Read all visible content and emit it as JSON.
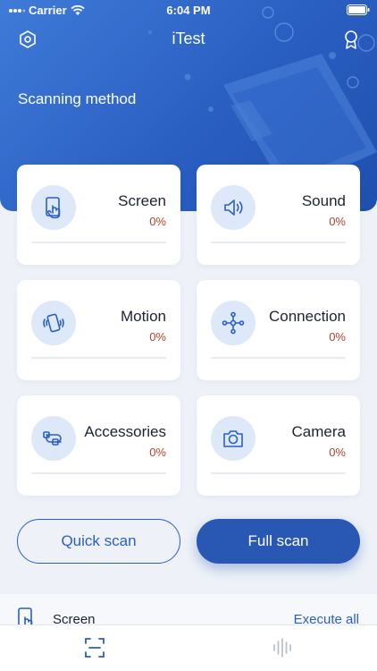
{
  "status_bar": {
    "carrier": "Carrier",
    "time": "6:04 PM"
  },
  "navbar": {
    "title": "iTest",
    "left_icon": "settings-hexagon-icon",
    "right_icon": "award-ribbon-icon"
  },
  "section_title": "Scanning method",
  "colors": {
    "primary": "#2a5fc2",
    "percent": "#b4412e",
    "background": "#eef2f8"
  },
  "cards": [
    {
      "id": "screen",
      "name": "Screen",
      "percent": "0%",
      "progress": 0,
      "icon": "touch-screen-icon"
    },
    {
      "id": "sound",
      "name": "Sound",
      "percent": "0%",
      "progress": 0,
      "icon": "speaker-icon"
    },
    {
      "id": "motion",
      "name": "Motion",
      "percent": "0%",
      "progress": 0,
      "icon": "phone-vibrate-icon"
    },
    {
      "id": "connection",
      "name": "Connection",
      "percent": "0%",
      "progress": 0,
      "icon": "network-nodes-icon"
    },
    {
      "id": "accessories",
      "name": "Accessories",
      "percent": "0%",
      "progress": 0,
      "icon": "cable-icon"
    },
    {
      "id": "camera",
      "name": "Camera",
      "percent": "0%",
      "progress": 0,
      "icon": "camera-icon"
    }
  ],
  "buttons": {
    "quick_scan": "Quick scan",
    "full_scan": "Full scan"
  },
  "bottom_list": {
    "first_item": "Screen",
    "execute_all": "Execute all"
  },
  "tabs": [
    {
      "id": "scan",
      "icon": "scan-frame-icon",
      "active": true
    },
    {
      "id": "sound-wave",
      "icon": "sound-wave-icon",
      "active": false
    }
  ]
}
